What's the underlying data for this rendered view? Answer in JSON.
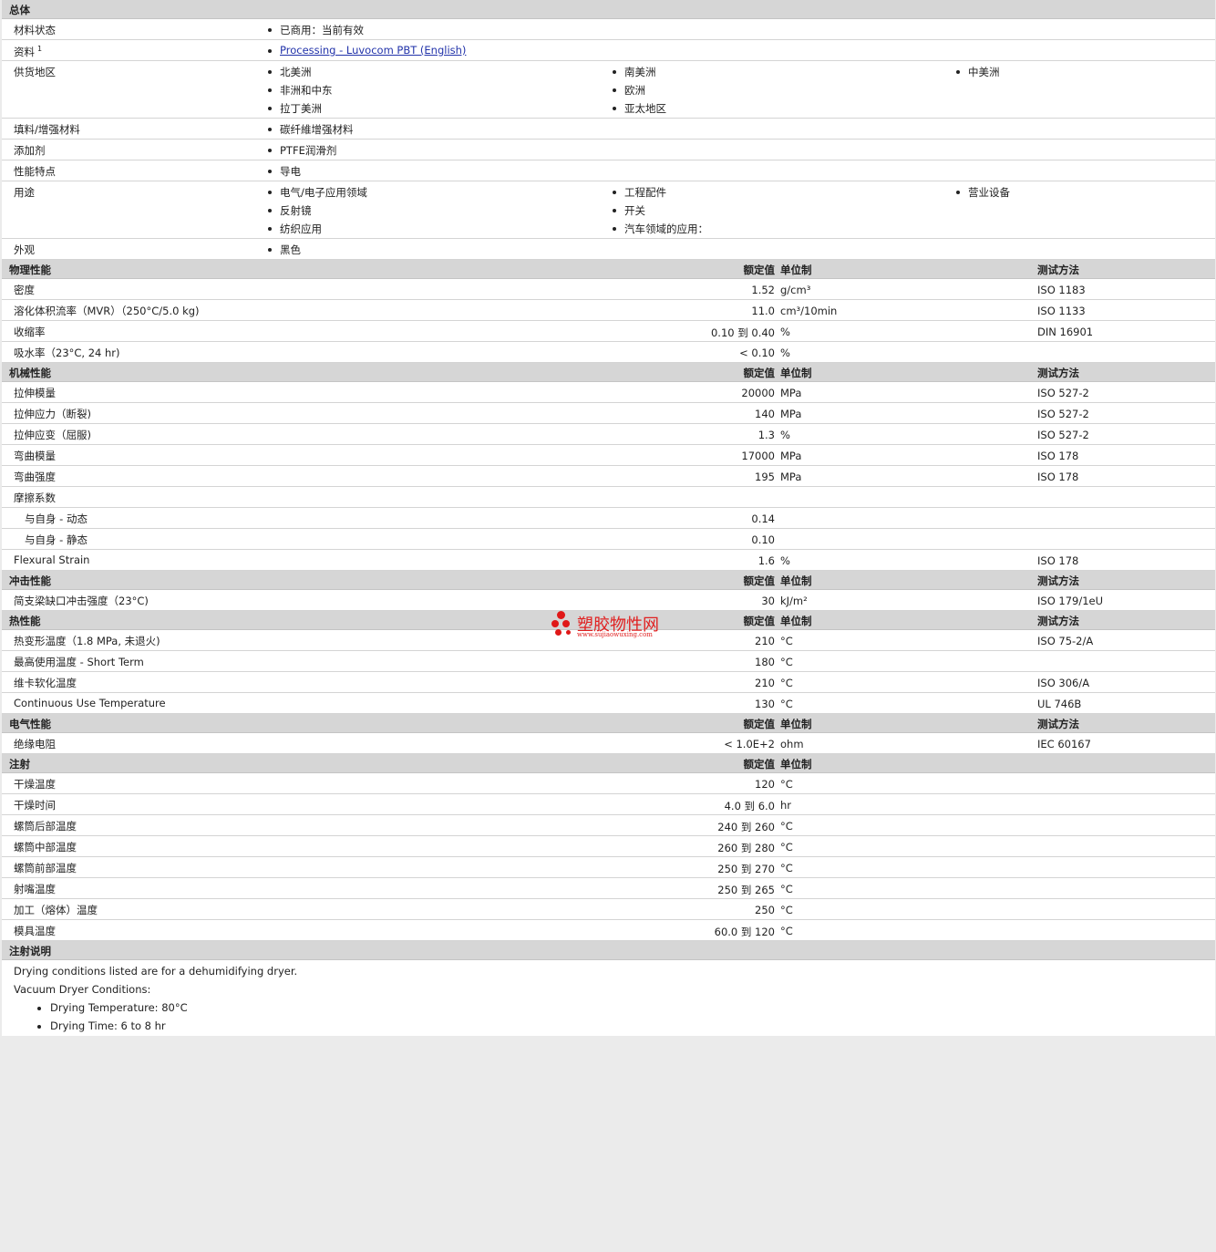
{
  "general": {
    "title": "总体",
    "status": {
      "label": "材料状态",
      "value": "已商用：当前有效"
    },
    "docs": {
      "label": "资料",
      "sup": "1",
      "link": "Processing - Luvocom PBT (English)"
    },
    "availability": {
      "label": "供货地区",
      "items": [
        "北美洲",
        "非洲和中东",
        "拉丁美洲",
        "南美洲",
        "欧洲",
        "亚太地区",
        "中美洲"
      ]
    },
    "filler": {
      "label": "填料/增强材料",
      "value": "碳纤維增强材料"
    },
    "additive": {
      "label": "添加剂",
      "value": "PTFE润滑剂"
    },
    "features": {
      "label": "性能特点",
      "value": "导电"
    },
    "uses": {
      "label": "用途",
      "items": [
        "电气/电子应用领域",
        "反射镜",
        "纺织应用",
        "工程配件",
        "开关",
        "汽车领域的应用：",
        "营业设备"
      ]
    },
    "appearance": {
      "label": "外观",
      "value": "黑色"
    }
  },
  "cols": {
    "nominal": "额定值",
    "unit": "单位制",
    "test": "测试方法"
  },
  "physical": {
    "title": "物理性能",
    "rows": [
      {
        "label": "密度",
        "value": "1.52",
        "unit": "g/cm³",
        "test": "ISO 1183"
      },
      {
        "label": "溶化体积流率（MVR）（250°C/5.0 kg)",
        "value": "11.0",
        "unit": "cm³/10min",
        "test": "ISO 1133"
      },
      {
        "label": "收缩率",
        "value": "0.10 到 0.40",
        "unit": "%",
        "test": "DIN 16901"
      },
      {
        "label": "吸水率（23°C, 24 hr)",
        "value": "< 0.10",
        "unit": "%",
        "test": ""
      }
    ]
  },
  "mechanical": {
    "title": "机械性能",
    "rows": [
      {
        "label": "拉伸模量",
        "value": "20000",
        "unit": "MPa",
        "test": "ISO 527-2"
      },
      {
        "label": "拉伸应力（断裂)",
        "value": "140",
        "unit": "MPa",
        "test": "ISO 527-2"
      },
      {
        "label": "拉伸应变（屈服)",
        "value": "1.3",
        "unit": "%",
        "test": "ISO 527-2"
      },
      {
        "label": "弯曲模量",
        "value": "17000",
        "unit": "MPa",
        "test": "ISO 178"
      },
      {
        "label": "弯曲强度",
        "value": "195",
        "unit": "MPa",
        "test": "ISO 178"
      },
      {
        "label": "摩擦系数",
        "value": "",
        "unit": "",
        "test": ""
      },
      {
        "label": "与自身 - 动态",
        "value": "0.14",
        "unit": "",
        "test": ""
      },
      {
        "label": "与自身 - 静态",
        "value": "0.10",
        "unit": "",
        "test": ""
      },
      {
        "label": "Flexural Strain",
        "value": "1.6",
        "unit": "%",
        "test": "ISO 178"
      }
    ]
  },
  "impact": {
    "title": "冲击性能",
    "rows": [
      {
        "label": "简支梁缺口冲击强度（23°C)",
        "value": "30",
        "unit": "kJ/m²",
        "test": "ISO 179/1eU"
      }
    ]
  },
  "thermal": {
    "title": "热性能",
    "rows": [
      {
        "label": "热变形温度（1.8 MPa, 未退火)",
        "value": "210",
        "unit": "°C",
        "test": "ISO 75-2/A"
      },
      {
        "label": "最高使用温度 - Short Term",
        "value": "180",
        "unit": "°C",
        "test": ""
      },
      {
        "label": "维卡软化温度",
        "value": "210",
        "unit": "°C",
        "test": "ISO 306/A"
      },
      {
        "label": "Continuous Use Temperature",
        "value": "130",
        "unit": "°C",
        "test": "UL 746B"
      }
    ]
  },
  "electrical": {
    "title": "电气性能",
    "rows": [
      {
        "label": "绝缘电阻",
        "value": "< 1.0E+2",
        "unit": "ohm",
        "test": "IEC 60167"
      }
    ]
  },
  "injection": {
    "title": "注射",
    "rows": [
      {
        "label": "干燥温度",
        "value": "120",
        "unit": "°C"
      },
      {
        "label": "干燥时间",
        "value": "4.0 到 6.0",
        "unit": "hr"
      },
      {
        "label": "螺筒后部温度",
        "value": "240 到 260",
        "unit": "°C"
      },
      {
        "label": "螺筒中部温度",
        "value": "260 到 280",
        "unit": "°C"
      },
      {
        "label": "螺筒前部温度",
        "value": "250 到 270",
        "unit": "°C"
      },
      {
        "label": "射嘴温度",
        "value": "250 到 265",
        "unit": "°C"
      },
      {
        "label": "加工（熔体）温度",
        "value": "250",
        "unit": "°C"
      },
      {
        "label": "模具温度",
        "value": "60.0 到 120",
        "unit": "°C"
      }
    ]
  },
  "notes": {
    "title": "注射说明",
    "line1": "Drying conditions listed are for a dehumidifying dryer.",
    "line2": "Vacuum Dryer Conditions:",
    "items": [
      "Drying Temperature: 80°C",
      "Drying Time: 6 to 8 hr"
    ]
  },
  "watermark": {
    "text": "塑胶物性网",
    "url": "www.sujiaowuxing.com"
  },
  "colors": {
    "header_bg": "#d6d6d6",
    "link": "#2233aa",
    "watermark": "#e02020",
    "page_bg": "#ebebeb"
  }
}
